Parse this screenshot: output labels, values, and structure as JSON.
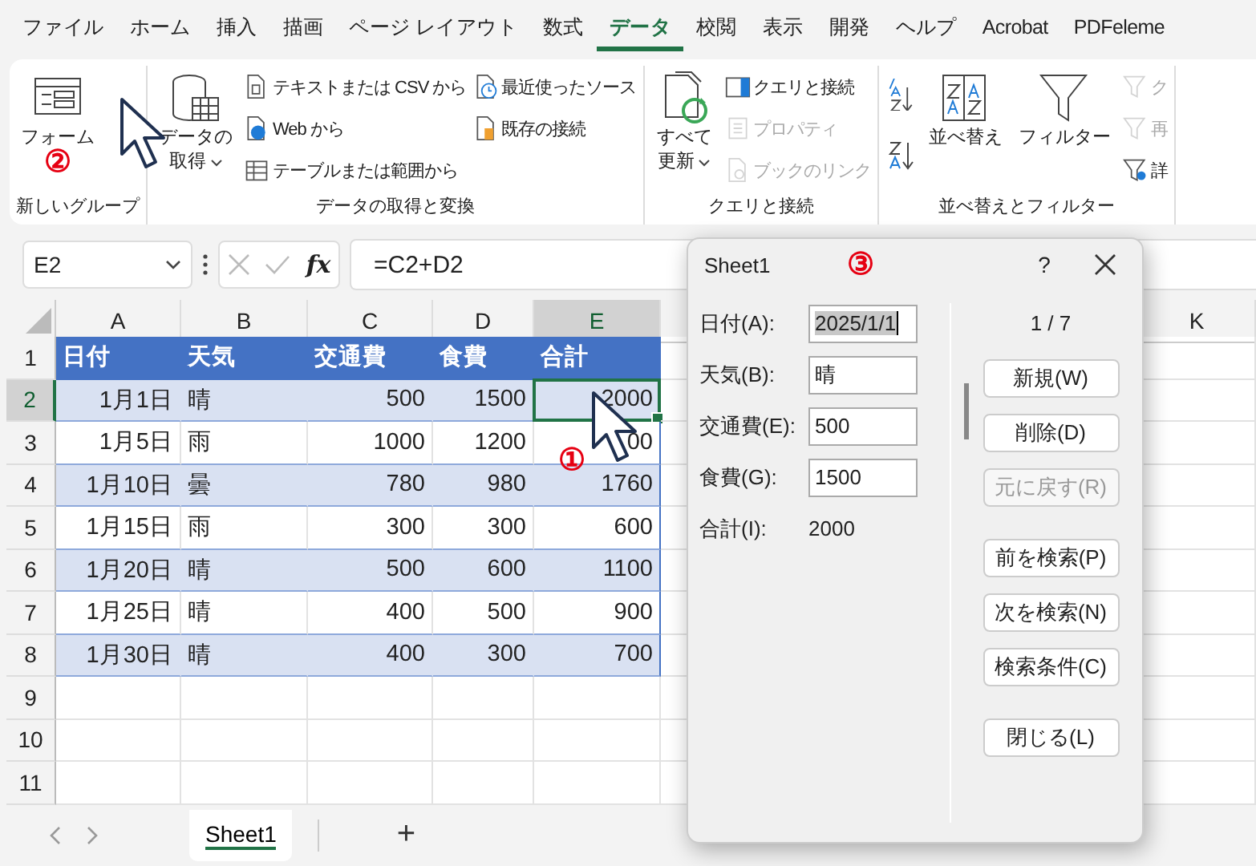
{
  "menu_tabs": [
    {
      "label": "ファイル",
      "selected": false
    },
    {
      "label": "ホーム",
      "selected": false
    },
    {
      "label": "挿入",
      "selected": false
    },
    {
      "label": "描画",
      "selected": false
    },
    {
      "label": "ページ レイアウト",
      "selected": false
    },
    {
      "label": "数式",
      "selected": false
    },
    {
      "label": "データ",
      "selected": true
    },
    {
      "label": "校閲",
      "selected": false
    },
    {
      "label": "表示",
      "selected": false
    },
    {
      "label": "開発",
      "selected": false
    },
    {
      "label": "ヘルプ",
      "selected": false
    },
    {
      "label": "Acrobat",
      "selected": false
    },
    {
      "label": "PDFeleme",
      "selected": false
    }
  ],
  "ribbon": {
    "groups": [
      {
        "label": "新しいグループ",
        "columns": [
          {
            "kind": "large",
            "lines": [
              "フォーム"
            ],
            "dropdown": false
          }
        ]
      },
      {
        "label": "データの取得と変換",
        "columns": [
          {
            "kind": "large",
            "lines": [
              "データの",
              "取得"
            ],
            "dropdown": true
          },
          {
            "kind": "small",
            "items": [
              {
                "label": "テキストまたは CSV から",
                "disabled": false
              },
              {
                "label": "Web から",
                "disabled": false
              },
              {
                "label": "テーブルまたは範囲から",
                "disabled": false
              }
            ]
          },
          {
            "kind": "small",
            "items": [
              {
                "label": "最近使ったソース",
                "disabled": false
              },
              {
                "label": "既存の接続",
                "disabled": false
              }
            ]
          }
        ]
      },
      {
        "label": "クエリと接続",
        "columns": [
          {
            "kind": "large",
            "lines": [
              "すべて",
              "更新"
            ],
            "dropdown": true
          },
          {
            "kind": "small",
            "items": [
              {
                "label": "クエリと接続",
                "disabled": false
              },
              {
                "label": "プロパティ",
                "disabled": true
              },
              {
                "label": "ブックのリンク",
                "disabled": true
              }
            ]
          }
        ]
      },
      {
        "label": "並べ替えとフィルター",
        "columns": [
          {
            "kind": "sort"
          },
          {
            "kind": "large",
            "lines": [
              "並べ替え"
            ],
            "dropdown": false
          },
          {
            "kind": "large",
            "lines": [
              "フィルター"
            ],
            "dropdown": false
          },
          {
            "kind": "small",
            "items": [
              {
                "label": "ク",
                "disabled": true
              },
              {
                "label": "再",
                "disabled": true
              },
              {
                "label": "詳",
                "disabled": false
              }
            ]
          }
        ]
      }
    ]
  },
  "formula_bar": {
    "name_box": "E2",
    "fx": "fx",
    "formula": "=C2+D2"
  },
  "sheet": {
    "columns": [
      {
        "label": "A",
        "selected": false
      },
      {
        "label": "B",
        "selected": false
      },
      {
        "label": "C",
        "selected": false
      },
      {
        "label": "D",
        "selected": false
      },
      {
        "label": "E",
        "selected": true
      }
    ],
    "columns_right": [
      {
        "label": "K",
        "selected": false
      }
    ],
    "rows": [
      {
        "number": "1",
        "selected": false,
        "kind": "table_header",
        "cells": [
          "日付",
          "天気",
          "交通費",
          "食費",
          "合計"
        ]
      },
      {
        "number": "2",
        "selected": true,
        "kind": "table_row",
        "cells": [
          "1月1日",
          "晴",
          "500",
          "1500",
          "2000"
        ]
      },
      {
        "number": "3",
        "selected": false,
        "kind": "table_row",
        "cells": [
          "1月5日",
          "雨",
          "1000",
          "1200",
          "00"
        ]
      },
      {
        "number": "4",
        "selected": false,
        "kind": "table_row",
        "cells": [
          "1月10日",
          "曇",
          "780",
          "980",
          "1760"
        ]
      },
      {
        "number": "5",
        "selected": false,
        "kind": "table_row",
        "cells": [
          "1月15日",
          "雨",
          "300",
          "300",
          "600"
        ]
      },
      {
        "number": "6",
        "selected": false,
        "kind": "table_row",
        "cells": [
          "1月20日",
          "晴",
          "500",
          "600",
          "1100"
        ]
      },
      {
        "number": "7",
        "selected": false,
        "kind": "table_row",
        "cells": [
          "1月25日",
          "晴",
          "400",
          "500",
          "900"
        ]
      },
      {
        "number": "8",
        "selected": false,
        "kind": "table_row",
        "cells": [
          "1月30日",
          "晴",
          "400",
          "300",
          "700"
        ]
      },
      {
        "number": "9",
        "selected": false,
        "kind": "empty"
      },
      {
        "number": "10",
        "selected": false,
        "kind": "empty"
      },
      {
        "number": "11",
        "selected": false,
        "kind": "empty"
      }
    ]
  },
  "sheet_tabs": [
    {
      "label": "Sheet1",
      "selected": true
    }
  ],
  "add_sheet": "+",
  "dialog": {
    "title": "Sheet1",
    "help": "?",
    "record": "1 / 7",
    "fields": [
      {
        "kind": "input",
        "label": "日付(A):",
        "value": "2025/1/1",
        "selected": true
      },
      {
        "kind": "input",
        "label": "天気(B):",
        "value": "晴",
        "selected": false
      },
      {
        "kind": "input",
        "label": "交通費(E):",
        "value": "500",
        "selected": false
      },
      {
        "kind": "input",
        "label": "食費(G):",
        "value": "1500",
        "selected": false
      },
      {
        "kind": "static",
        "label": "合計(I):",
        "value": "2000",
        "selected": false
      }
    ],
    "buttons": [
      {
        "label": "新規(W)",
        "disabled": false
      },
      {
        "label": "削除(D)",
        "disabled": false
      },
      {
        "label": "元に戻す(R)",
        "disabled": true
      },
      {
        "label": "前を検索(P)",
        "disabled": false
      },
      {
        "label": "次を検索(N)",
        "disabled": false
      },
      {
        "label": "検索条件(C)",
        "disabled": false
      },
      {
        "label": "閉じる(L)",
        "disabled": false
      }
    ]
  },
  "annotations": [
    {
      "label": "①"
    },
    {
      "label": "②"
    },
    {
      "label": "③"
    }
  ]
}
